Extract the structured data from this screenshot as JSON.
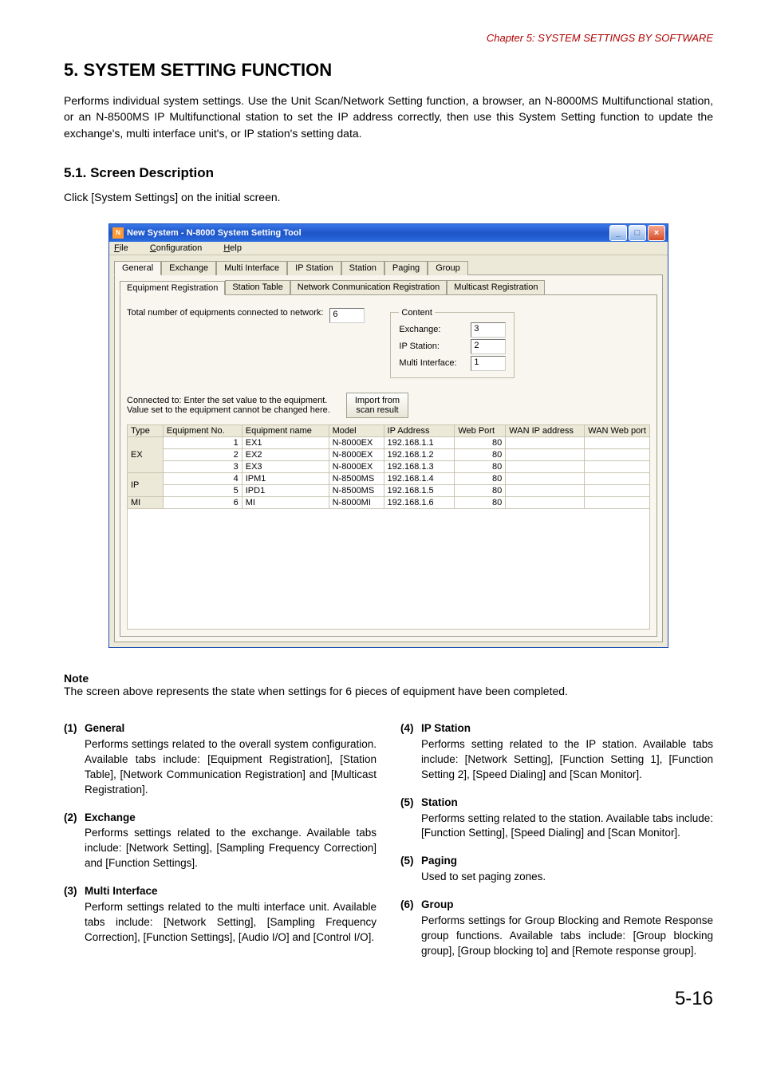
{
  "chapter": "Chapter 5:  SYSTEM SETTINGS BY SOFTWARE",
  "heading": "5. SYSTEM SETTING FUNCTION",
  "intro": "Performs individual system settings. Use the Unit Scan/Network Setting function, a browser, an N-8000MS Multifunctional station, or an N-8500MS IP Multifunctional station to set the IP address correctly, then use this System Setting function to update the exchange's, multi interface unit's, or IP station's setting data.",
  "subheading": "5.1. Screen Description",
  "clickline": "Click [System Settings] on the initial screen.",
  "window": {
    "title": "New System - N-8000 System Setting Tool",
    "menu": {
      "file": "File",
      "config": "Configuration",
      "help": "Help"
    },
    "tabs": [
      "General",
      "Exchange",
      "Multi Interface",
      "IP Station",
      "Station",
      "Paging",
      "Group"
    ],
    "subtabs": [
      "Equipment Registration",
      "Station Table",
      "Network Conmunication Registration",
      "Multicast Registration"
    ],
    "total_label": "Total number of equipments connected to network:",
    "total_value": "6",
    "content_label": "Content",
    "c_exchange_l": "Exchange:",
    "c_exchange_v": "3",
    "c_ip_l": "IP Station:",
    "c_ip_v": "2",
    "c_mi_l": "Multi Interface:",
    "c_mi_v": "1",
    "hint1": "Connected to: Enter the set value to the equipment.",
    "hint2": "Value set to the equipment cannot be changed here.",
    "btn_import1": "Import from",
    "btn_import2": "scan result",
    "headers": [
      "Type",
      "Equipment No.",
      "Equipment name",
      "Model",
      "IP Address",
      "Web Port",
      "WAN IP address",
      "WAN Web port"
    ],
    "rows": [
      {
        "type": "EX",
        "no": "1",
        "name": "EX1",
        "model": "N-8000EX",
        "ip": "192.168.1.1",
        "port": "80"
      },
      {
        "type": "",
        "no": "2",
        "name": "EX2",
        "model": "N-8000EX",
        "ip": "192.168.1.2",
        "port": "80"
      },
      {
        "type": "",
        "no": "3",
        "name": "EX3",
        "model": "N-8000EX",
        "ip": "192.168.1.3",
        "port": "80"
      },
      {
        "type": "IP",
        "no": "4",
        "name": "IPM1",
        "model": "N-8500MS",
        "ip": "192.168.1.4",
        "port": "80"
      },
      {
        "type": "",
        "no": "5",
        "name": "IPD1",
        "model": "N-8500MS",
        "ip": "192.168.1.5",
        "port": "80"
      },
      {
        "type": "MI",
        "no": "6",
        "name": "MI",
        "model": "N-8000MI",
        "ip": "192.168.1.6",
        "port": "80"
      }
    ]
  },
  "note_h": "Note",
  "note_b": "The screen above represents the state when settings for 6 pieces of equipment have been completed.",
  "items_left": [
    {
      "n": "(1)",
      "t": "General",
      "b": "Performs settings related to the overall system configuration. Available tabs include: [Equipment Registration], [Station Table], [Network Communication Registration] and [Multicast Registration]."
    },
    {
      "n": "(2)",
      "t": "Exchange",
      "b": "Performs settings related to the exchange. Available tabs include: [Network Setting], [Sampling Frequency Correction] and [Function Settings]."
    },
    {
      "n": "(3)",
      "t": "Multi Interface",
      "b": "Perform settings related to the multi interface unit. Available tabs include: [Network Setting], [Sampling Frequency Correction], [Function Settings], [Audio I/O] and [Control I/O]."
    }
  ],
  "items_right": [
    {
      "n": "(4)",
      "t": "IP Station",
      "b": "Performs setting related to the IP station. Available tabs include: [Network Setting], [Function Setting 1], [Function Setting 2], [Speed Dialing] and [Scan Monitor]."
    },
    {
      "n": "(5)",
      "t": "Station",
      "b": "Performs setting related to the station. Available tabs include: [Function Setting], [Speed Dialing] and [Scan Monitor]."
    },
    {
      "n": "(5)",
      "t": "Paging",
      "b": "Used to set paging zones."
    },
    {
      "n": "(6)",
      "t": "Group",
      "b": "Performs settings for Group Blocking and Remote Response group functions. Available tabs include: [Group blocking group], [Group blocking to] and [Remote response group]."
    }
  ],
  "pagenum": "5-16"
}
